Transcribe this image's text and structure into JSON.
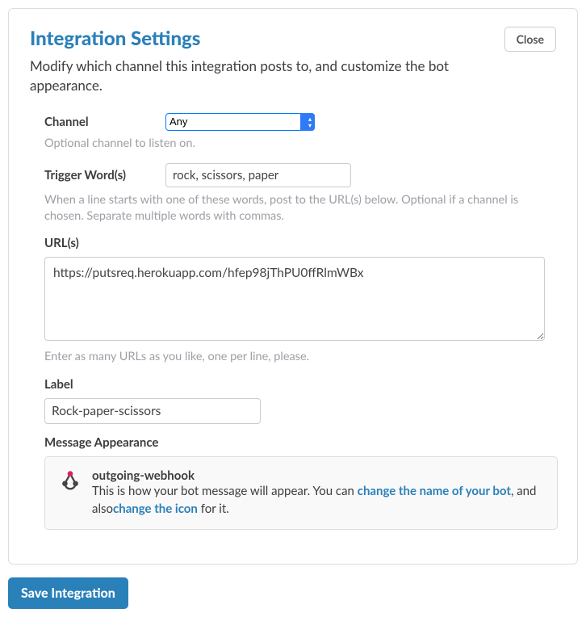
{
  "header": {
    "title": "Integration Settings",
    "close": "Close",
    "subtitle": "Modify which channel this integration posts to, and customize the bot appearance."
  },
  "channel": {
    "label": "Channel",
    "selected": "Any",
    "help": "Optional channel to listen on."
  },
  "trigger": {
    "label": "Trigger Word(s)",
    "value": "rock, scissors, paper",
    "help": "When a line starts with one of these words, post to the URL(s) below. Optional if a channel is chosen. Separate multiple words with commas."
  },
  "urls": {
    "label": "URL(s)",
    "value": "https://putsreq.herokuapp.com/hfep98jThPU0ffRlmWBx",
    "help": "Enter as many URLs as you like, one per line, please."
  },
  "label_field": {
    "label": "Label",
    "value": "Rock-paper-scissors"
  },
  "appearance": {
    "label": "Message Appearance",
    "bot_name": "outgoing-webhook",
    "desc_prefix": "This is how your bot message will appear. You can ",
    "link1": "change the name of your bot",
    "mid": ", and also",
    "link2": "change the icon",
    "suffix": " for it."
  },
  "footer": {
    "save": "Save Integration"
  }
}
